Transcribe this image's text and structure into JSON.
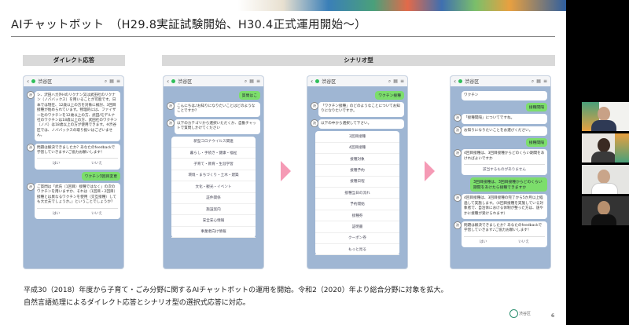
{
  "title": "AIチャットボット　（H29.8実証試験開始、H30.4正式運用開始～）",
  "headers": {
    "direct": "ダイレクト応答",
    "scenario": "シナリオ型"
  },
  "phone_header": {
    "name": "渋谷区",
    "back": "<"
  },
  "phone1": {
    "bubble1": "シ、沢田ハガ外Hのリクナン又は武田社のリクナン（ノババックス）を用いることが可能です。日本では現在、12歳以上の方を対象に検討、3回目接種が始められています。物理的には、ファイザー社のワクチンを12歳以上の方、武田/モデルナ社のワクチンは18歳以上の方、武田社のワクチン（ノバ）は18歳以上の方が使用できます。※渋谷区では、ノババックスの取り扱いはございません。",
    "bubble2": "問題は解決できましたか？あなたのfeedbackで学習していきます♪ご協力お願いします！",
    "yes": "はい",
    "no": "いいえ",
    "user": "ワクチン3回目変更",
    "bubble3": "ご質問は「武氏（1回目）接種ではなく」の次のワクチンを用いますか、それは（1回目・2回目）接種とは異なるワクチンを使用（交互接種）しても大丈夫でしょうか。」ということでしょうか？"
  },
  "phone2": {
    "user": "質問はこ",
    "bubble1": "こんにちは♪お知りになりたいことはどのようなことですか？",
    "bubble2": "以下のカテゴリから選択いただくか、自動チャットで質問しかけてください",
    "menu": [
      "新型コロナウイルス関連",
      "暮らし・手続き・健康・福祉",
      "子育て・教育・生涯学習",
      "環境・まちづくり・土木・建築",
      "文化・観光・イベント",
      "証件関係",
      "施設案内",
      "安全安心情報",
      "事業者向け情報"
    ]
  },
  "phone3": {
    "user": "ワクチン接種",
    "bubble1": "「ワクチン接種」のどのようなことについてお知りになりたいですか。",
    "bubble2": "以下の中から選択して下さい。",
    "menu": [
      "3回目接種",
      "4回目接種",
      "接種対象",
      "接種予約",
      "接種日程",
      "接種当日の流れ",
      "予約開始",
      "接種券",
      "証明書",
      "クーポン券",
      "もっと見る"
    ]
  },
  "phone4": {
    "top": "ワクチン",
    "user1": "接種間隔",
    "bubble1": "「接種間隔」についてですね。",
    "bubble2": "お知りになりたいことをお選びください。",
    "user2": "接種間隔",
    "bubble3": "4回目接種は、3回目接種からどのくらい期間をあければよいですか",
    "bubble3b": "該当するものがありません",
    "user3": "3回目接種は、3回目接種からどのくらい期間をあけたら接種できますか",
    "bubble4": "4回目接種は、3回目接種の完了から5か月以上経過して実施します。（4回目接種を実施している対象者で、自治体における体制が整った方は、速やかに接種が受けられます）",
    "bubble5": "問題は解決できましたか？あなたのfeedbackで学習していきます♪ご協力お願いします！",
    "yes": "はい",
    "no": "いいえ"
  },
  "caption1": "平成30（2018）年度から子育て・ごみ分野に関するAIチャットボットの運用を開始。令和2（2020）年より総合分野に対象を拡大。",
  "caption2": "自然言語処理によるダイレクト応答とシナリオ型の選択式応答に対応。",
  "logo": "渋谷区",
  "page": "6",
  "participants": [
    "",
    "",
    "",
    ""
  ],
  "colors": {
    "phone_bg": "#9fb6d3",
    "user_bubble": "#7cde6b",
    "arrow": "#f59ab5",
    "header_bg": "#d9d9d9"
  }
}
